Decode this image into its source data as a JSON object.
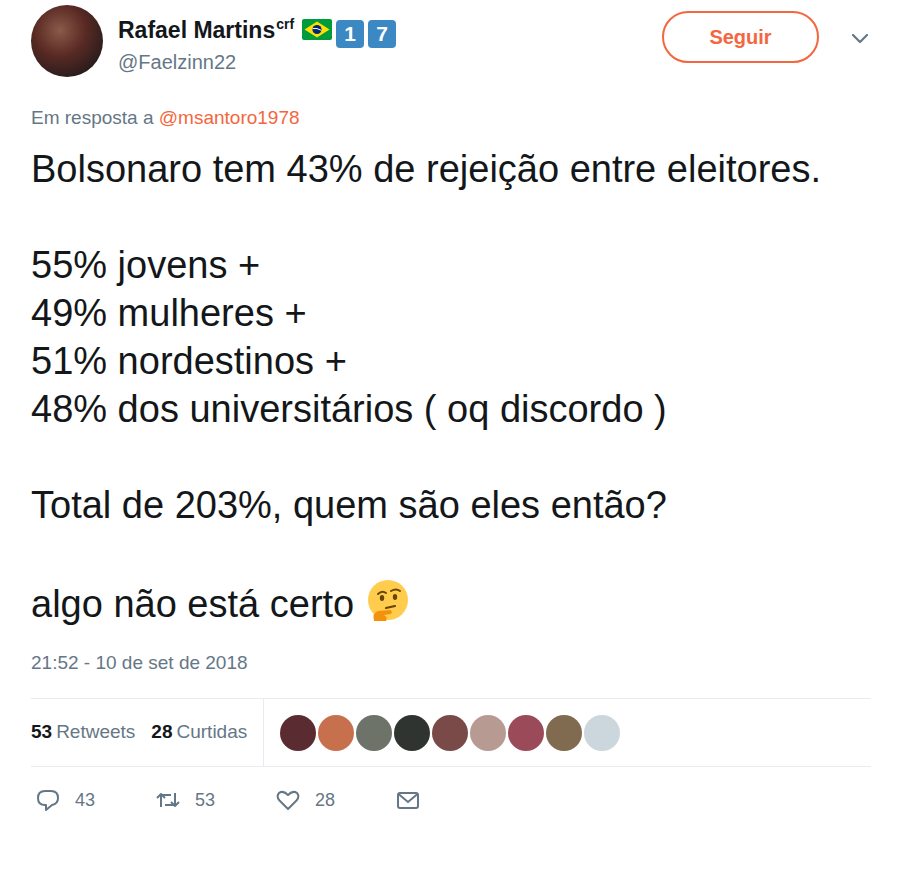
{
  "author": {
    "name": "Rafael Martins",
    "name_sup": "crf",
    "badges": [
      "1",
      "7"
    ],
    "handle": "@Faelzinn22"
  },
  "follow_button": "Seguir",
  "reply_to": {
    "prefix": "Em resposta a",
    "user": "@msantoro1978"
  },
  "tweet_paragraphs": [
    [
      "Bolsonaro tem 43% de rejeição entre eleitores."
    ],
    [
      "55% jovens +",
      "49% mulheres +",
      "51% nordestinos +",
      "48% dos universitários ( oq discordo )"
    ],
    [
      "Total de 203%, quem são eles então?"
    ],
    [
      "algo não está certo"
    ]
  ],
  "timestamp": "21:52 - 10 de set de 2018",
  "stats": [
    {
      "count": "53",
      "label": "Retweets"
    },
    {
      "count": "28",
      "label": "Curtidas"
    }
  ],
  "actions": [
    {
      "kind": "reply",
      "count": "43"
    },
    {
      "kind": "retweet",
      "count": "53"
    },
    {
      "kind": "like",
      "count": "28"
    },
    {
      "kind": "message"
    }
  ]
}
